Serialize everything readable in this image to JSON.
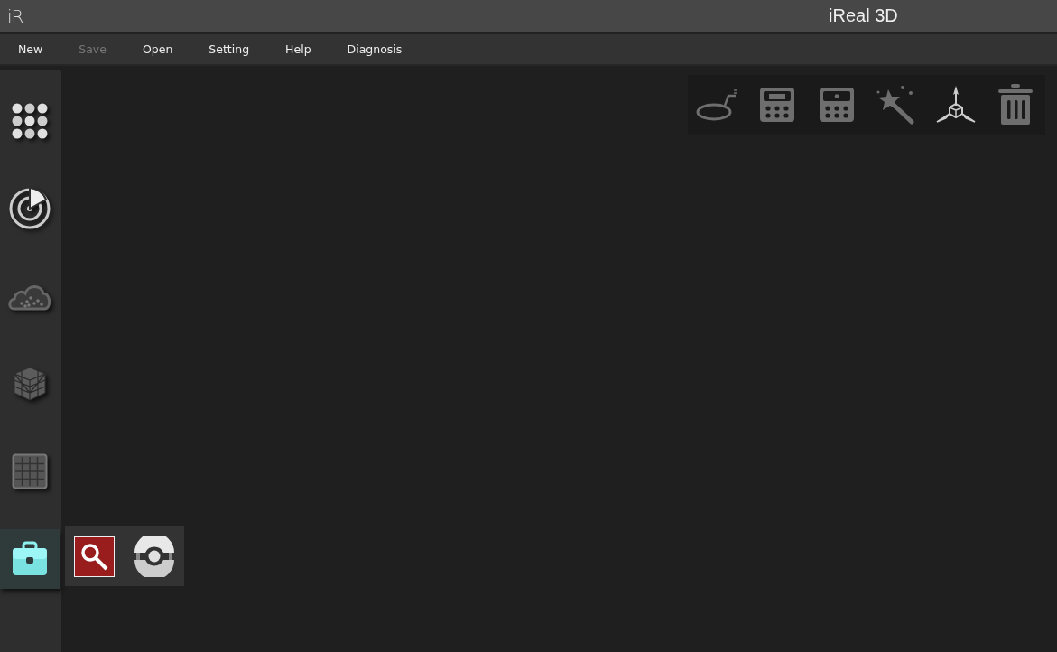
{
  "window": {
    "logo": "iR",
    "title": "iReal 3D"
  },
  "menu": [
    {
      "label": "New",
      "disabled": false
    },
    {
      "label": "Save",
      "disabled": true
    },
    {
      "label": "Open",
      "disabled": false
    },
    {
      "label": "Setting",
      "disabled": false
    },
    {
      "label": "Help",
      "disabled": false
    },
    {
      "label": "Diagnosis",
      "disabled": false
    }
  ],
  "sidebar": {
    "items": [
      {
        "kind": "dots",
        "selected": false
      },
      {
        "kind": "scan",
        "selected": false
      },
      {
        "kind": "cloud",
        "selected": false
      },
      {
        "kind": "mesh",
        "selected": false
      },
      {
        "kind": "grid",
        "selected": false
      },
      {
        "kind": "toolbox",
        "selected": true
      }
    ]
  },
  "flyout": [
    {
      "kind": "search"
    },
    {
      "kind": "ring"
    }
  ],
  "toolbar": [
    {
      "kind": "lasso"
    },
    {
      "kind": "keypad-bar"
    },
    {
      "kind": "keypad-dot"
    },
    {
      "kind": "wand"
    },
    {
      "kind": "axes"
    },
    {
      "kind": "trash"
    }
  ]
}
